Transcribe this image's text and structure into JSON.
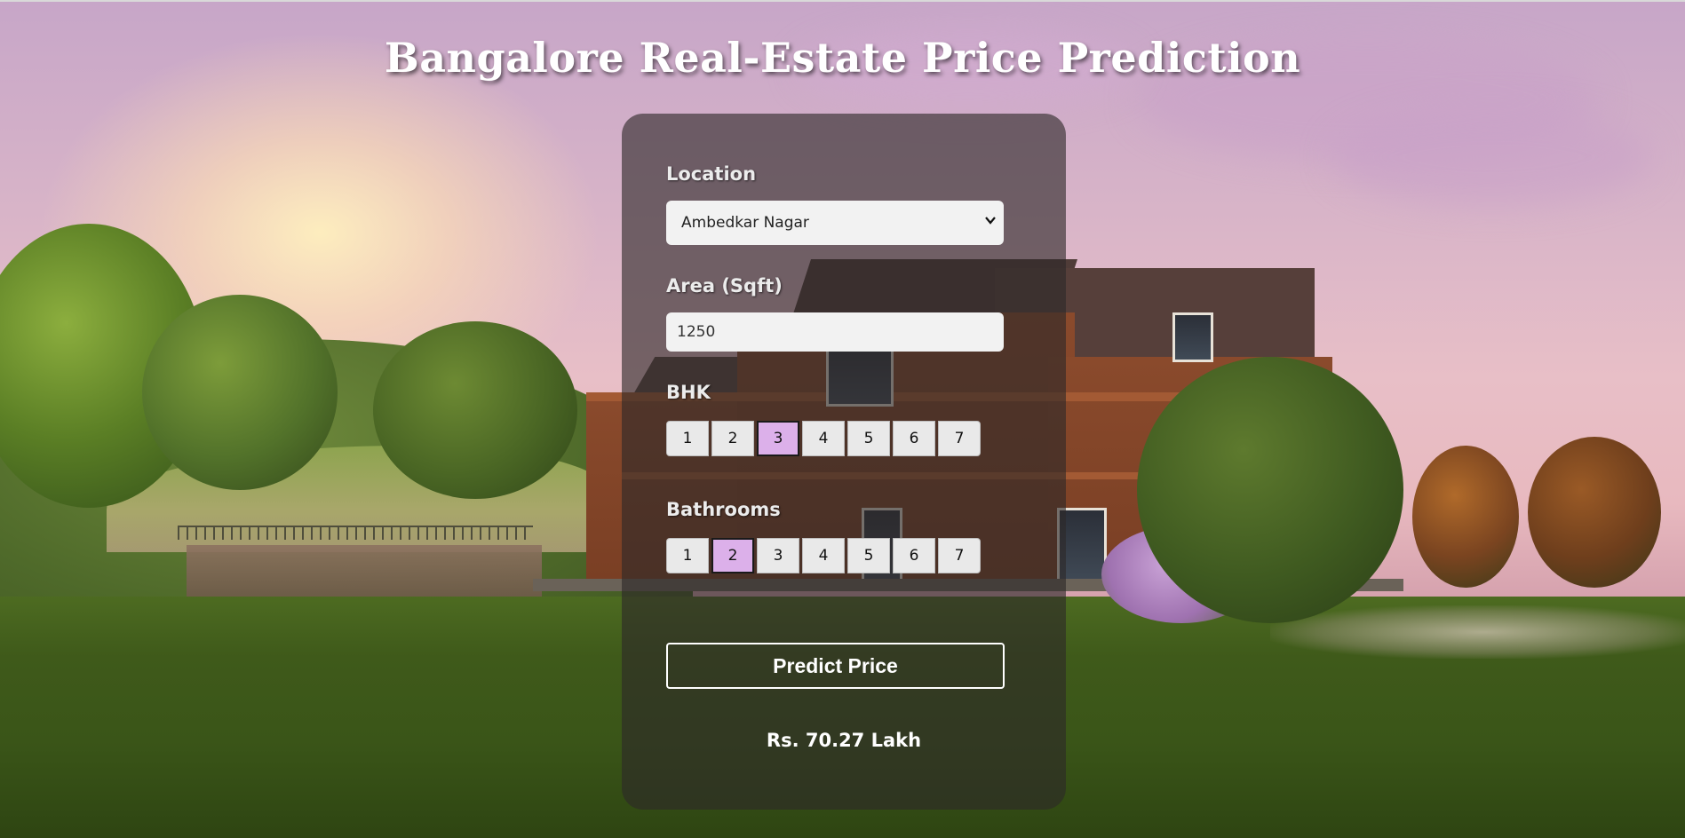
{
  "page": {
    "title": "Bangalore Real-Estate Price Prediction"
  },
  "form": {
    "location": {
      "label": "Location",
      "selected": "Ambedkar Nagar",
      "icon": "chevron-down-icon"
    },
    "area": {
      "label": "Area (Sqft)",
      "value": "1250"
    },
    "bhk": {
      "label": "BHK",
      "options": [
        "1",
        "2",
        "3",
        "4",
        "5",
        "6",
        "7"
      ],
      "selected": "3"
    },
    "bathrooms": {
      "label": "Bathrooms",
      "options": [
        "1",
        "2",
        "3",
        "4",
        "5",
        "6",
        "7"
      ],
      "selected": "2"
    },
    "predict_button": "Predict Price",
    "result": "Rs. 70.27 Lakh"
  },
  "colors": {
    "selected_option": "#dcb0ea",
    "card_overlay": "rgba(45,40,40,0.62)"
  }
}
